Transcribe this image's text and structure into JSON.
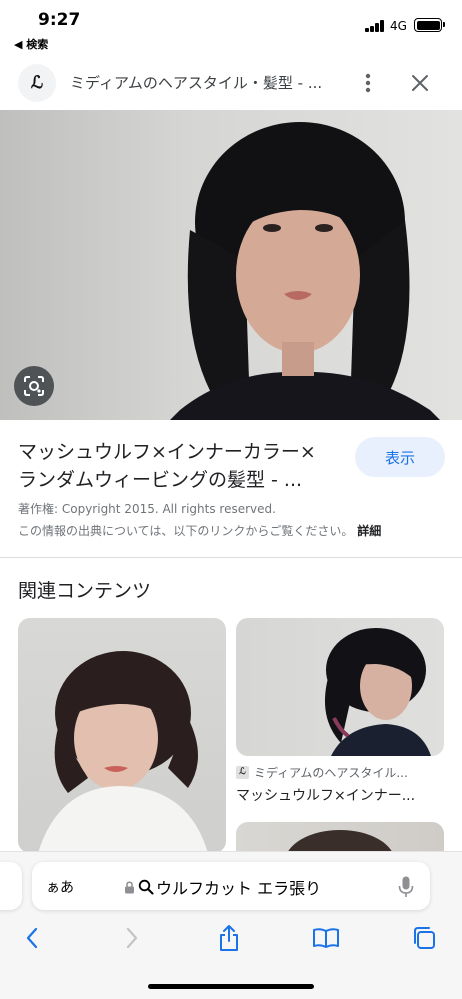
{
  "status_bar": {
    "time": "9:27",
    "back_app": "◀ 検索",
    "network": "4G"
  },
  "header": {
    "logo_text": "ℒ",
    "title": "ミディアムのヘアスタイル・髪型 - ..."
  },
  "result": {
    "title_line1": "マッシュウルフ×インナーカラー×",
    "title_line2": "ランダムウィービングの髪型 - ...",
    "show_button": "表示",
    "copyright": "著作権: Copyright 2015. All rights reserved.",
    "source_note": "この情報の出典については、以下のリンクからご覧ください。",
    "details_link": "詳細"
  },
  "related": {
    "heading": "関連コンテンツ",
    "items": [
      {
        "source": "",
        "title": ""
      },
      {
        "source": "ミディアムのヘアスタイル...",
        "title": "マッシュウルフ×インナー..."
      }
    ]
  },
  "browser": {
    "aa_label": "ぁあ",
    "url_text": "ウルフカット エラ張り"
  },
  "colors": {
    "accent": "#1a73e8",
    "accent_bg": "#e8f0fe",
    "text_secondary": "#70757a"
  },
  "icons": [
    "more-vert-icon",
    "close-icon",
    "lens-icon",
    "lock-icon",
    "search-icon",
    "mic-icon",
    "back-icon",
    "forward-icon",
    "share-icon",
    "bookmarks-icon",
    "tabs-icon"
  ]
}
